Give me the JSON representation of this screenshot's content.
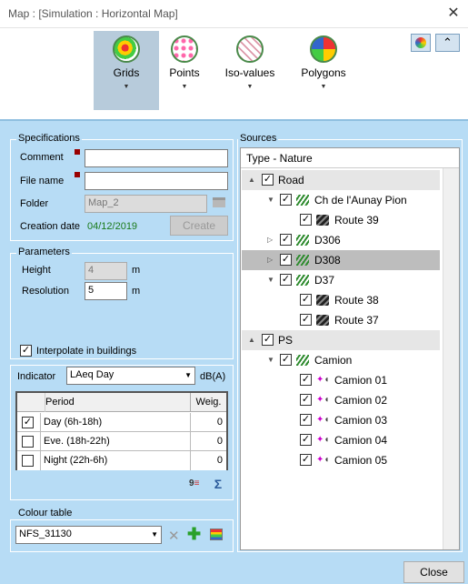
{
  "window": {
    "title": "Map :  [Simulation : Horizontal Map]"
  },
  "ribbon": {
    "buttons": [
      {
        "label": "Grids",
        "selected": true
      },
      {
        "label": "Points"
      },
      {
        "label": "Iso-values"
      },
      {
        "label": "Polygons"
      }
    ],
    "dropdown_glyph": "▼"
  },
  "spec": {
    "group_title": "Specifications",
    "comment_label": "Comment",
    "comment_value": "",
    "filename_label": "File name",
    "filename_value": "",
    "folder_label": "Folder",
    "folder_value": "Map_2",
    "creation_label": "Creation date",
    "creation_value": "04/12/2019",
    "create_btn": "Create"
  },
  "params": {
    "group_title": "Parameters",
    "height_label": "Height",
    "height_value": "4",
    "height_unit": "m",
    "res_label": "Resolution",
    "res_value": "5",
    "res_unit": "m",
    "interp_label": "Interpolate in buildings",
    "interp_checked": true
  },
  "indicator": {
    "label": "Indicator",
    "value": "LAeq Day",
    "unit": "dB(A)"
  },
  "periods": {
    "headers": [
      "Period",
      "Weig."
    ],
    "rows": [
      {
        "name": "Day (6h-18h)",
        "weight": "0",
        "checked": true
      },
      {
        "name": "Eve. (18h-22h)",
        "weight": "0",
        "checked": false
      },
      {
        "name": "Night (22h-6h)",
        "weight": "0",
        "checked": false
      }
    ]
  },
  "colour": {
    "group_title": "Colour table",
    "value": "NFS_31130"
  },
  "sources": {
    "group_title": "Sources",
    "header": "Type - Nature",
    "items": [
      {
        "label": "Road",
        "level": 0,
        "twisty": "▲",
        "icon": "none",
        "style": "group"
      },
      {
        "label": "Ch de l'Aunay Pion",
        "level": 1,
        "twisty": "▼",
        "icon": "road",
        "style": ""
      },
      {
        "label": "Route 39",
        "level": 2,
        "twisty": "",
        "icon": "rail",
        "style": ""
      },
      {
        "label": "D306",
        "level": 1,
        "twisty": "▷",
        "icon": "road",
        "style": ""
      },
      {
        "label": "D308",
        "level": 1,
        "twisty": "▷",
        "icon": "road",
        "style": "highlight"
      },
      {
        "label": "D37",
        "level": 1,
        "twisty": "▼",
        "icon": "road",
        "style": ""
      },
      {
        "label": "Route 38",
        "level": 2,
        "twisty": "",
        "icon": "rail",
        "style": ""
      },
      {
        "label": "Route 37",
        "level": 2,
        "twisty": "",
        "icon": "rail",
        "style": ""
      },
      {
        "label": "PS",
        "level": 0,
        "twisty": "▲",
        "icon": "none",
        "style": "group"
      },
      {
        "label": "Camion",
        "level": 1,
        "twisty": "▼",
        "icon": "road",
        "style": ""
      },
      {
        "label": "Camion 01",
        "level": 2,
        "twisty": "",
        "icon": "point",
        "style": ""
      },
      {
        "label": "Camion 02",
        "level": 2,
        "twisty": "",
        "icon": "point",
        "style": ""
      },
      {
        "label": "Camion 03",
        "level": 2,
        "twisty": "",
        "icon": "point",
        "style": ""
      },
      {
        "label": "Camion 04",
        "level": 2,
        "twisty": "",
        "icon": "point",
        "style": ""
      },
      {
        "label": "Camion 05",
        "level": 2,
        "twisty": "",
        "icon": "point",
        "style": ""
      }
    ]
  },
  "footer": {
    "close_btn": "Close"
  },
  "colors": {
    "accent": "#b7dcf5",
    "selected": "#b7cbdb",
    "road_icon": "#2e8b2e",
    "required": "#990000"
  }
}
